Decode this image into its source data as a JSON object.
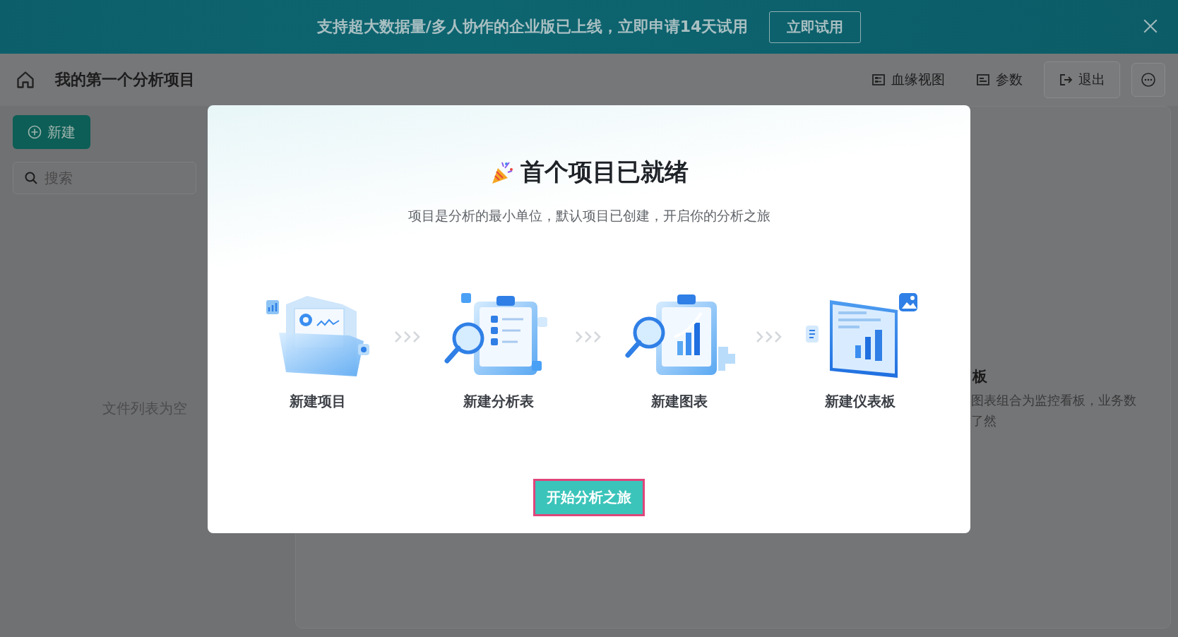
{
  "banner": {
    "text": "支持超大数据量/多人协作的企业版已上线，立即申请14天试用",
    "button": "立即试用"
  },
  "header": {
    "title": "我的第一个分析项目",
    "actions": [
      {
        "label": "血缘视图",
        "kind": "lineage"
      },
      {
        "label": "参数",
        "kind": "params"
      },
      {
        "label": "退出",
        "kind": "exit"
      }
    ]
  },
  "sidebar": {
    "new_button": "新建",
    "search": {
      "placeholder": "搜索"
    },
    "empty_text": "文件列表为空"
  },
  "background_panel": {
    "title": "板",
    "lines": [
      "图表组合为监控看板，业务数",
      "了然"
    ]
  },
  "modal": {
    "title": "首个项目已就绪",
    "subtitle": "项目是分析的最小单位，默认项目已创建，开启你的分析之旅",
    "steps": [
      {
        "label": "新建项目",
        "kind": "folder"
      },
      {
        "label": "新建分析表",
        "kind": "checklist"
      },
      {
        "label": "新建图表",
        "kind": "chart"
      },
      {
        "label": "新建仪表板",
        "kind": "dashboard"
      }
    ],
    "button": "开始分析之旅"
  }
}
